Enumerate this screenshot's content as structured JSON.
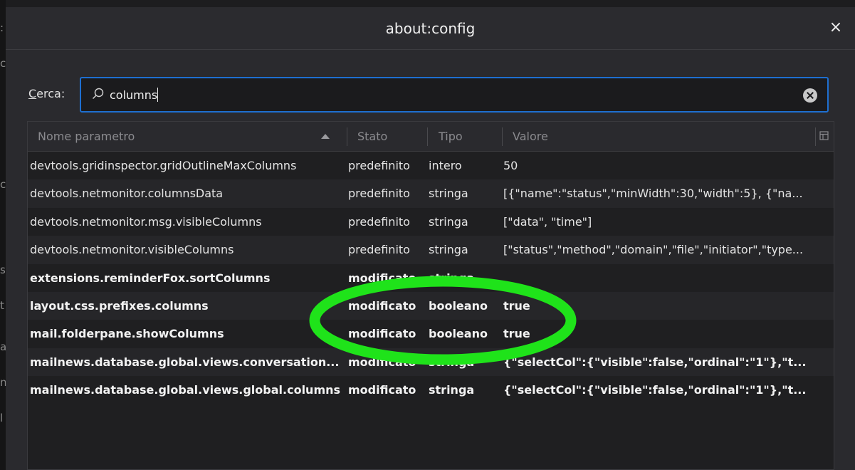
{
  "dialog": {
    "title": "about:config",
    "close_label": "×"
  },
  "search": {
    "label_mnemonic": "C",
    "label_rest": "erca:",
    "value": "columns"
  },
  "table": {
    "columns": [
      "Nome parametro",
      "Stato",
      "Tipo",
      "Valore"
    ],
    "rows": [
      {
        "name": "devtools.gridinspector.gridOutlineMaxColumns",
        "stato": "predefinito",
        "tipo": "intero",
        "valore": "50",
        "bold": false
      },
      {
        "name": "devtools.netmonitor.columnsData",
        "stato": "predefinito",
        "tipo": "stringa",
        "valore": "[{\"name\":\"status\",\"minWidth\":30,\"width\":5}, {\"na...",
        "bold": false
      },
      {
        "name": "devtools.netmonitor.msg.visibleColumns",
        "stato": "predefinito",
        "tipo": "stringa",
        "valore": "[\"data\", \"time\"]",
        "bold": false
      },
      {
        "name": "devtools.netmonitor.visibleColumns",
        "stato": "predefinito",
        "tipo": "stringa",
        "valore": "[\"status\",\"method\",\"domain\",\"file\",\"initiator\",\"type...",
        "bold": false
      },
      {
        "name": "extensions.reminderFox.sortColumns",
        "stato": "modificato",
        "tipo": "stringa",
        "valore": "",
        "bold": true
      },
      {
        "name": "layout.css.prefixes.columns",
        "stato": "modificato",
        "tipo": "booleano",
        "valore": "true",
        "bold": true
      },
      {
        "name": "mail.folderpane.showColumns",
        "stato": "modificato",
        "tipo": "booleano",
        "valore": "true",
        "bold": true
      },
      {
        "name": "mailnews.database.global.views.conversation...",
        "stato": "modificato",
        "tipo": "stringa",
        "valore": "{\"selectCol\":{\"visible\":false,\"ordinal\":\"1\"},\"t...",
        "bold": true
      },
      {
        "name": "mailnews.database.global.views.global.columns",
        "stato": "modificato",
        "tipo": "stringa",
        "valore": "{\"selectCol\":{\"visible\":false,\"ordinal\":\"1\"},\"t...",
        "bold": true
      }
    ]
  },
  "colors": {
    "accent": "#1e6fd0",
    "annotation": "#1fe31a"
  }
}
